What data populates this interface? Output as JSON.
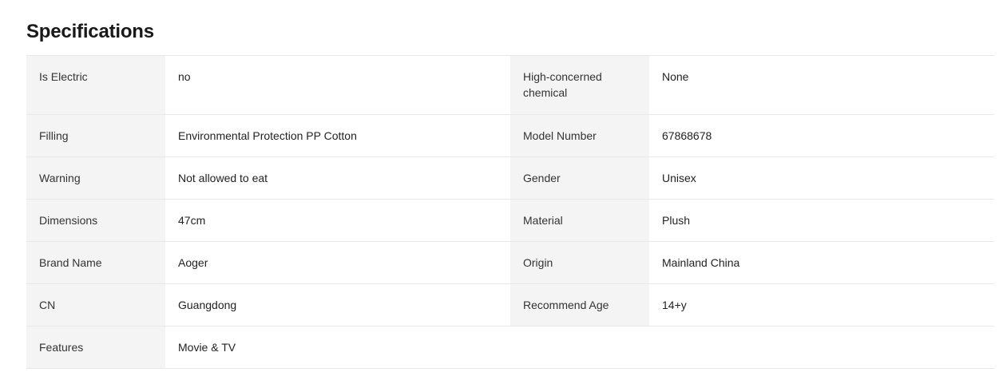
{
  "title": "Specifications",
  "rows": [
    {
      "k1": "Is Electric",
      "v1": "no",
      "k2": "High-concerned chemical",
      "v2": "None"
    },
    {
      "k1": "Filling",
      "v1": "Environmental Protection PP Cotton",
      "k2": "Model Number",
      "v2": "67868678"
    },
    {
      "k1": "Warning",
      "v1": "Not allowed to eat",
      "k2": "Gender",
      "v2": "Unisex"
    },
    {
      "k1": "Dimensions",
      "v1": "47cm",
      "k2": "Material",
      "v2": "Plush"
    },
    {
      "k1": "Brand Name",
      "v1": "Aoger",
      "k2": "Origin",
      "v2": "Mainland China"
    },
    {
      "k1": "CN",
      "v1": "Guangdong",
      "k2": "Recommend Age",
      "v2": "14+y"
    },
    {
      "k1": "Features",
      "v1": "Movie & TV"
    }
  ]
}
